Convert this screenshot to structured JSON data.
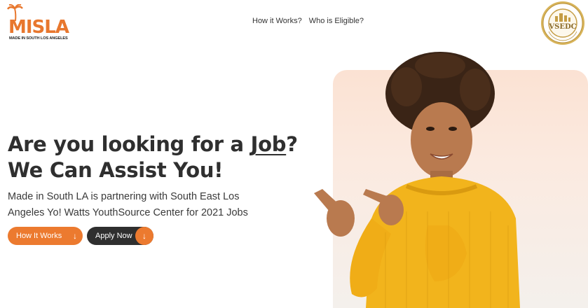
{
  "header": {
    "logo": {
      "word_first": "M",
      "word_rest": "ISLA",
      "tagline": "MADE IN SOUTH LOS ANGELES",
      "icon": "palm-tree-icon"
    },
    "nav": [
      {
        "label": "How it Works?"
      },
      {
        "label": "Who is Eligible?"
      }
    ],
    "seal": {
      "text": "VSEDC",
      "ring_text": "VERMONT SLAUSON ECONOMIC DEVELOPMENT CORPORATION"
    }
  },
  "hero": {
    "headline_part1": "Are you looking for a ",
    "headline_link": "Job",
    "headline_part2": "?",
    "headline_line2": "We Can Assist You!",
    "subtext": "Made in South LA is partnering with South East Los Angeles Yo! Watts YouthSource Center for 2021 Jobs",
    "buttons": {
      "how": {
        "label": "How It Works",
        "icon": "arrow-down-icon"
      },
      "apply": {
        "label": "Apply Now",
        "icon": "arrow-down-icon"
      }
    }
  },
  "colors": {
    "accent": "#ec7a2f",
    "dark": "#2f2f2f",
    "hero_bg": "#fbe2d3",
    "sweater": "#f2b41c"
  }
}
